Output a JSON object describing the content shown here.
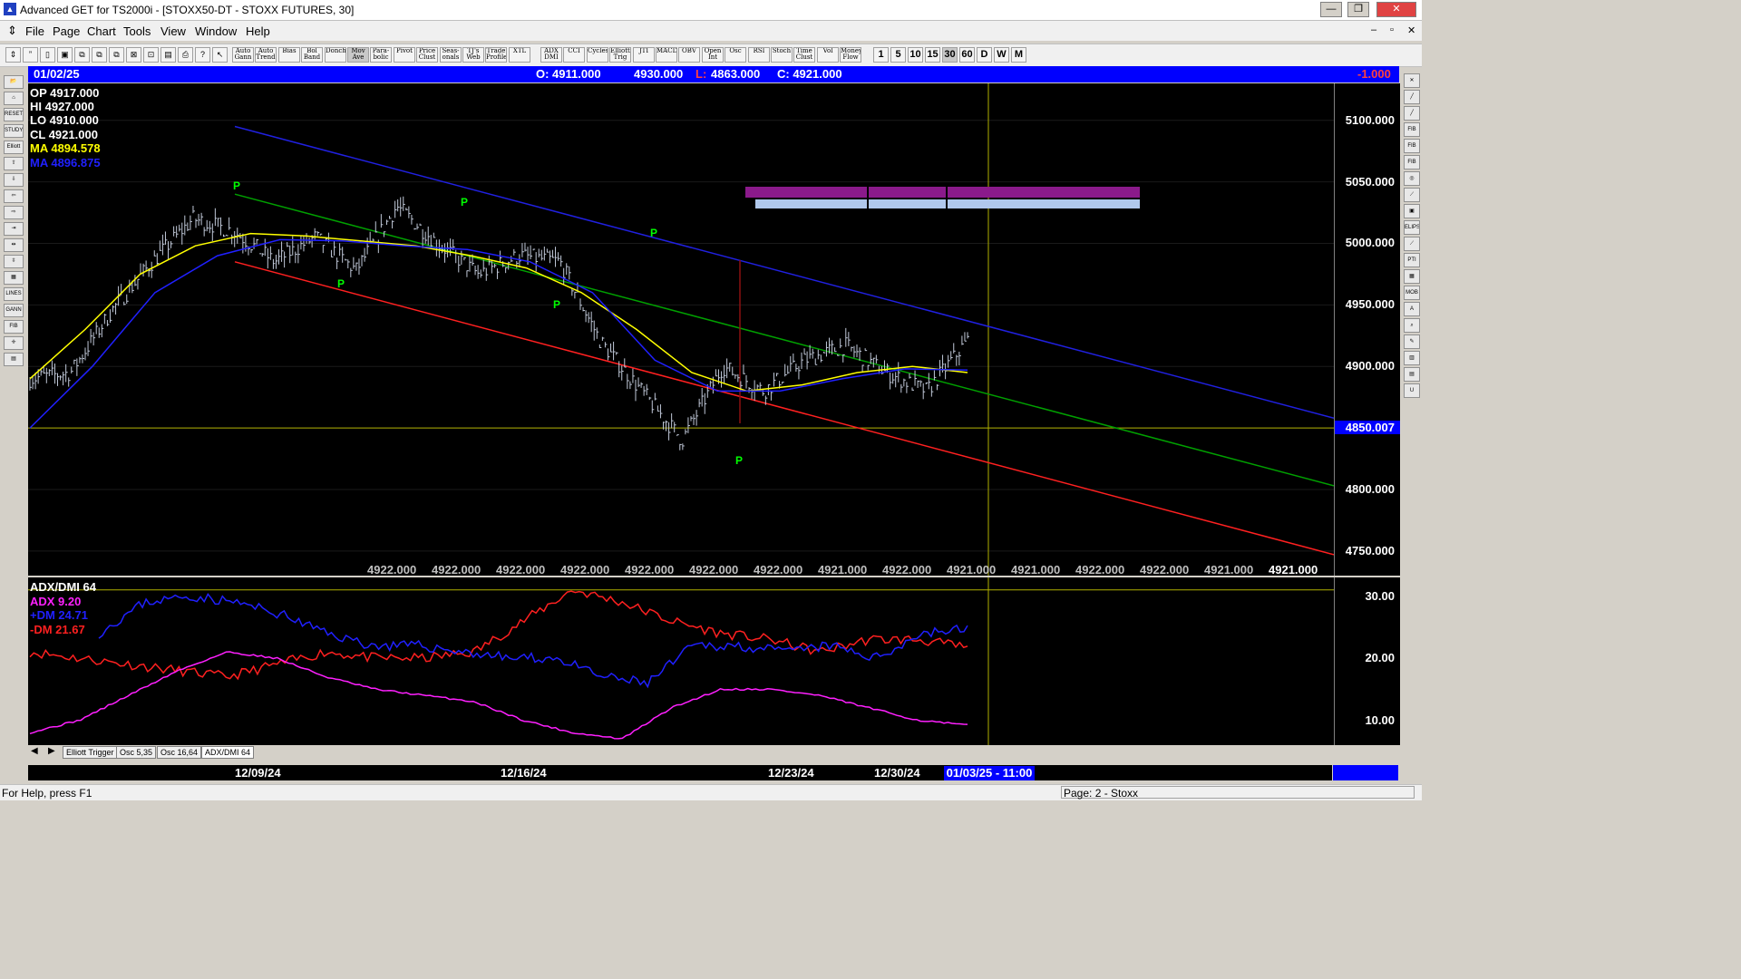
{
  "window": {
    "title": "Advanced GET for TS2000i - [STOXX50-DT - STOXX FUTURES, 30]",
    "min_label": "—",
    "max_label": "❐",
    "close_label": "✕"
  },
  "menu": {
    "items": [
      "File",
      "Page",
      "Chart",
      "Tools",
      "View",
      "Window",
      "Help"
    ]
  },
  "toolbar": {
    "study_buttons": [
      "Auto Gann",
      "Auto Trend",
      "Bias",
      "Bol Band",
      "Donch",
      "Mov Ave",
      "Para- bolic",
      "Pivot",
      "Price Clust",
      "Seas- onals",
      "TJ's Web",
      "Trade Profile",
      "XTL",
      "ADX DMI",
      "CCI",
      "Cycles",
      "Elliott Trig",
      "JTI",
      "MACD",
      "OBV",
      "Open Int",
      "Osc",
      "RSI",
      "Stoch",
      "Time Clust",
      "Vol",
      "Money Flow"
    ],
    "interval_buttons": [
      "1",
      "5",
      "10",
      "15",
      "30",
      "60",
      "D",
      "W",
      "M"
    ],
    "selected_interval": "30"
  },
  "left_tools": [
    "📂",
    "⌂",
    "RESET",
    "STUDY",
    "Elliott",
    "⇧",
    "⇩",
    "⇦",
    "⇨",
    "⇥",
    "⇹",
    "⇳",
    "▦",
    "LINES",
    "GANN",
    "FIB",
    "✛",
    "▤"
  ],
  "right_tools": [
    "✕",
    "╱",
    "╱",
    "FIB RET",
    "FIB EXT",
    "FIB TIME",
    "◎",
    "⟋",
    "▣",
    "ELIPS",
    "⟋",
    "PTI",
    "▦",
    "MOB",
    "A",
    "⌕",
    "✎",
    "▥",
    "▤",
    "U"
  ],
  "info_bar": {
    "date": "01/02/25",
    "open": "O: 4911.000",
    "high": "4930.000",
    "low_prefix": "L:",
    "low": "4863.000",
    "close": "C: 4921.000",
    "change": "-1.000"
  },
  "ohlc_readout": {
    "op": "OP  4917.000",
    "hi": "HI   4927.000",
    "lo": "LO  4910.000",
    "cl": "CL  4921.000",
    "ma1": "MA  4894.578",
    "ma2": "MA  4896.875"
  },
  "colors": {
    "ma_fast": "#ffff00",
    "ma_slow": "#2020ff",
    "upper_trend": "#2020e0",
    "mid_trend": "#00a000",
    "lower_trend": "#ff2020",
    "adx": "#ff20ff",
    "plus_dm": "#2020ff",
    "minus_dm": "#ff2020",
    "pivot_marker": "#00ff00",
    "price_bars": "#c0c8d8"
  },
  "price_scale": {
    "labels": [
      "5100.000",
      "5050.000",
      "5000.000",
      "4950.000",
      "4900.000",
      "4850.007",
      "4800.000",
      "4750.000"
    ],
    "highlight": "4850.007"
  },
  "bottom_values": [
    "4922.000",
    "4922.000",
    "4922.000",
    "4922.000",
    "4922.000",
    "4922.000",
    "4922.000",
    "4921.000",
    "4922.000",
    "4921.000",
    "4921.000",
    "4922.000",
    "4922.000",
    "4921.000",
    "4921.000"
  ],
  "pivot_label": "P",
  "adx_panel": {
    "title": "ADX/DMI 64",
    "adx_label": "ADX 9.20",
    "plus_label": "+DM 24.71",
    "minus_label": "-DM  21.67",
    "scale": [
      "30.00",
      "20.00",
      "10.00"
    ]
  },
  "tabs": {
    "items": [
      "Elliott Trigger",
      "Osc 5,35",
      "Osc 16,64",
      "ADX/DMI 64"
    ],
    "active": "ADX/DMI 64"
  },
  "dates": {
    "labels": [
      "12/09/24",
      "12/16/24",
      "12/23/24",
      "12/30/24"
    ],
    "current": "01/03/25 - 11:00"
  },
  "status": {
    "help": "For Help, press F1",
    "page": "Page: 2 - Stoxx"
  },
  "chart_data": {
    "type": "line",
    "title": "",
    "x": [
      "12/09/24",
      "12/16/24",
      "12/23/24",
      "12/30/24",
      "01/03/25 - 11:00"
    ],
    "ylim": [
      4730,
      5130
    ],
    "series": [
      {
        "name": "",
        "kind": "price_path",
        "values": [
          4890,
          4895,
          4945,
          4985,
          5020,
          5010,
          4985,
          5005,
          4978,
          5030,
          5000,
          4975,
          4990,
          4985,
          4920,
          4880,
          4840,
          4900,
          4880,
          4905,
          4917,
          4895,
          4880,
          4921
        ]
      },
      {
        "name": "",
        "kind": "ma",
        "values": [
          4890,
          4930,
          4975,
          4998,
          5008,
          5006,
          5002,
          4998,
          4990,
          4980,
          4960,
          4930,
          4895,
          4880,
          4885,
          4895,
          4900,
          4895
        ]
      },
      {
        "name": "",
        "kind": "ma",
        "values": [
          4850,
          4900,
          4960,
          4990,
          5003,
          5002,
          4998,
          4995,
          4985,
          4960,
          4905,
          4880,
          4880,
          4890,
          4898,
          4897
        ]
      }
    ],
    "trendlines": [
      {
        "name": "",
        "from": 5095,
        "to": 4858
      },
      {
        "name": "",
        "from": 5040,
        "to": 4803
      },
      {
        "name": "",
        "from": 4985,
        "to": 4747
      }
    ],
    "horizontal_line": 4850.007,
    "adx": {
      "ylim": [
        6,
        33
      ],
      "adx": [
        8,
        10,
        14,
        18,
        21,
        20,
        17,
        15,
        14,
        13,
        10,
        8,
        7,
        12,
        15,
        15,
        14,
        12,
        10,
        9.2
      ],
      "plus_dm": [
        24,
        29,
        30,
        29,
        27,
        24,
        22,
        22,
        21,
        20,
        20,
        17,
        16,
        22,
        22,
        21,
        22,
        20,
        24,
        24.71
      ],
      "minus_dm": [
        21,
        20,
        19,
        18,
        17,
        19,
        21,
        20,
        20,
        21,
        26,
        31,
        29,
        26,
        24,
        23,
        21,
        23,
        23,
        21.67
      ]
    }
  }
}
